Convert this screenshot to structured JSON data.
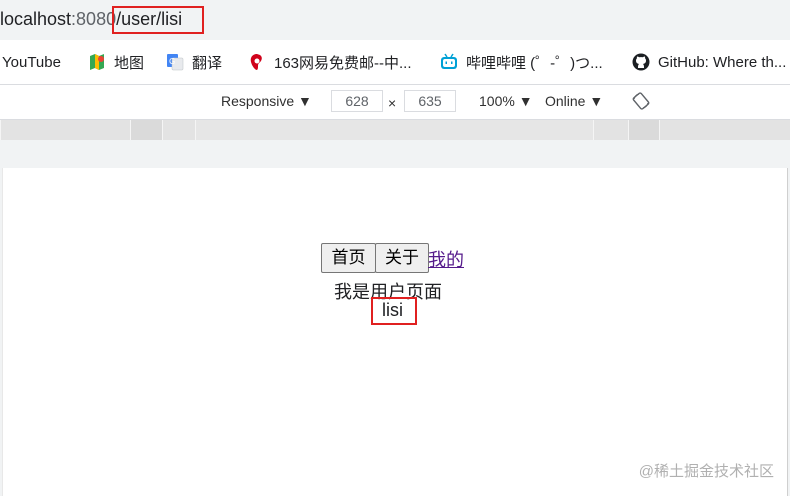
{
  "address_bar": {
    "host": "localhost",
    "port": ":8080",
    "path": "/user/lisi"
  },
  "bookmarks": [
    {
      "label": "YouTube",
      "icon": "youtube-icon"
    },
    {
      "label": "地图",
      "icon": "maps-icon"
    },
    {
      "label": "翻译",
      "icon": "translate-icon"
    },
    {
      "label": "163网易免费邮--中...",
      "icon": "netease-mail-icon"
    },
    {
      "label": "哔哩哔哩 (゜-゜)つ...",
      "icon": "bilibili-icon"
    },
    {
      "label": "GitHub: Where th...",
      "icon": "github-icon"
    }
  ],
  "devtools": {
    "device": "Responsive",
    "width": "628",
    "times": "×",
    "height": "635",
    "zoom": "100%",
    "network": "Online"
  },
  "page": {
    "home_button": "首页",
    "about_button": "关于",
    "my_link": "我的",
    "user_page_text": "我是用户页面",
    "username": "lisi"
  },
  "watermark": "@稀土掘金技术社区",
  "colors": {
    "highlight": "#e02020",
    "visited_link": "#551a8b"
  }
}
